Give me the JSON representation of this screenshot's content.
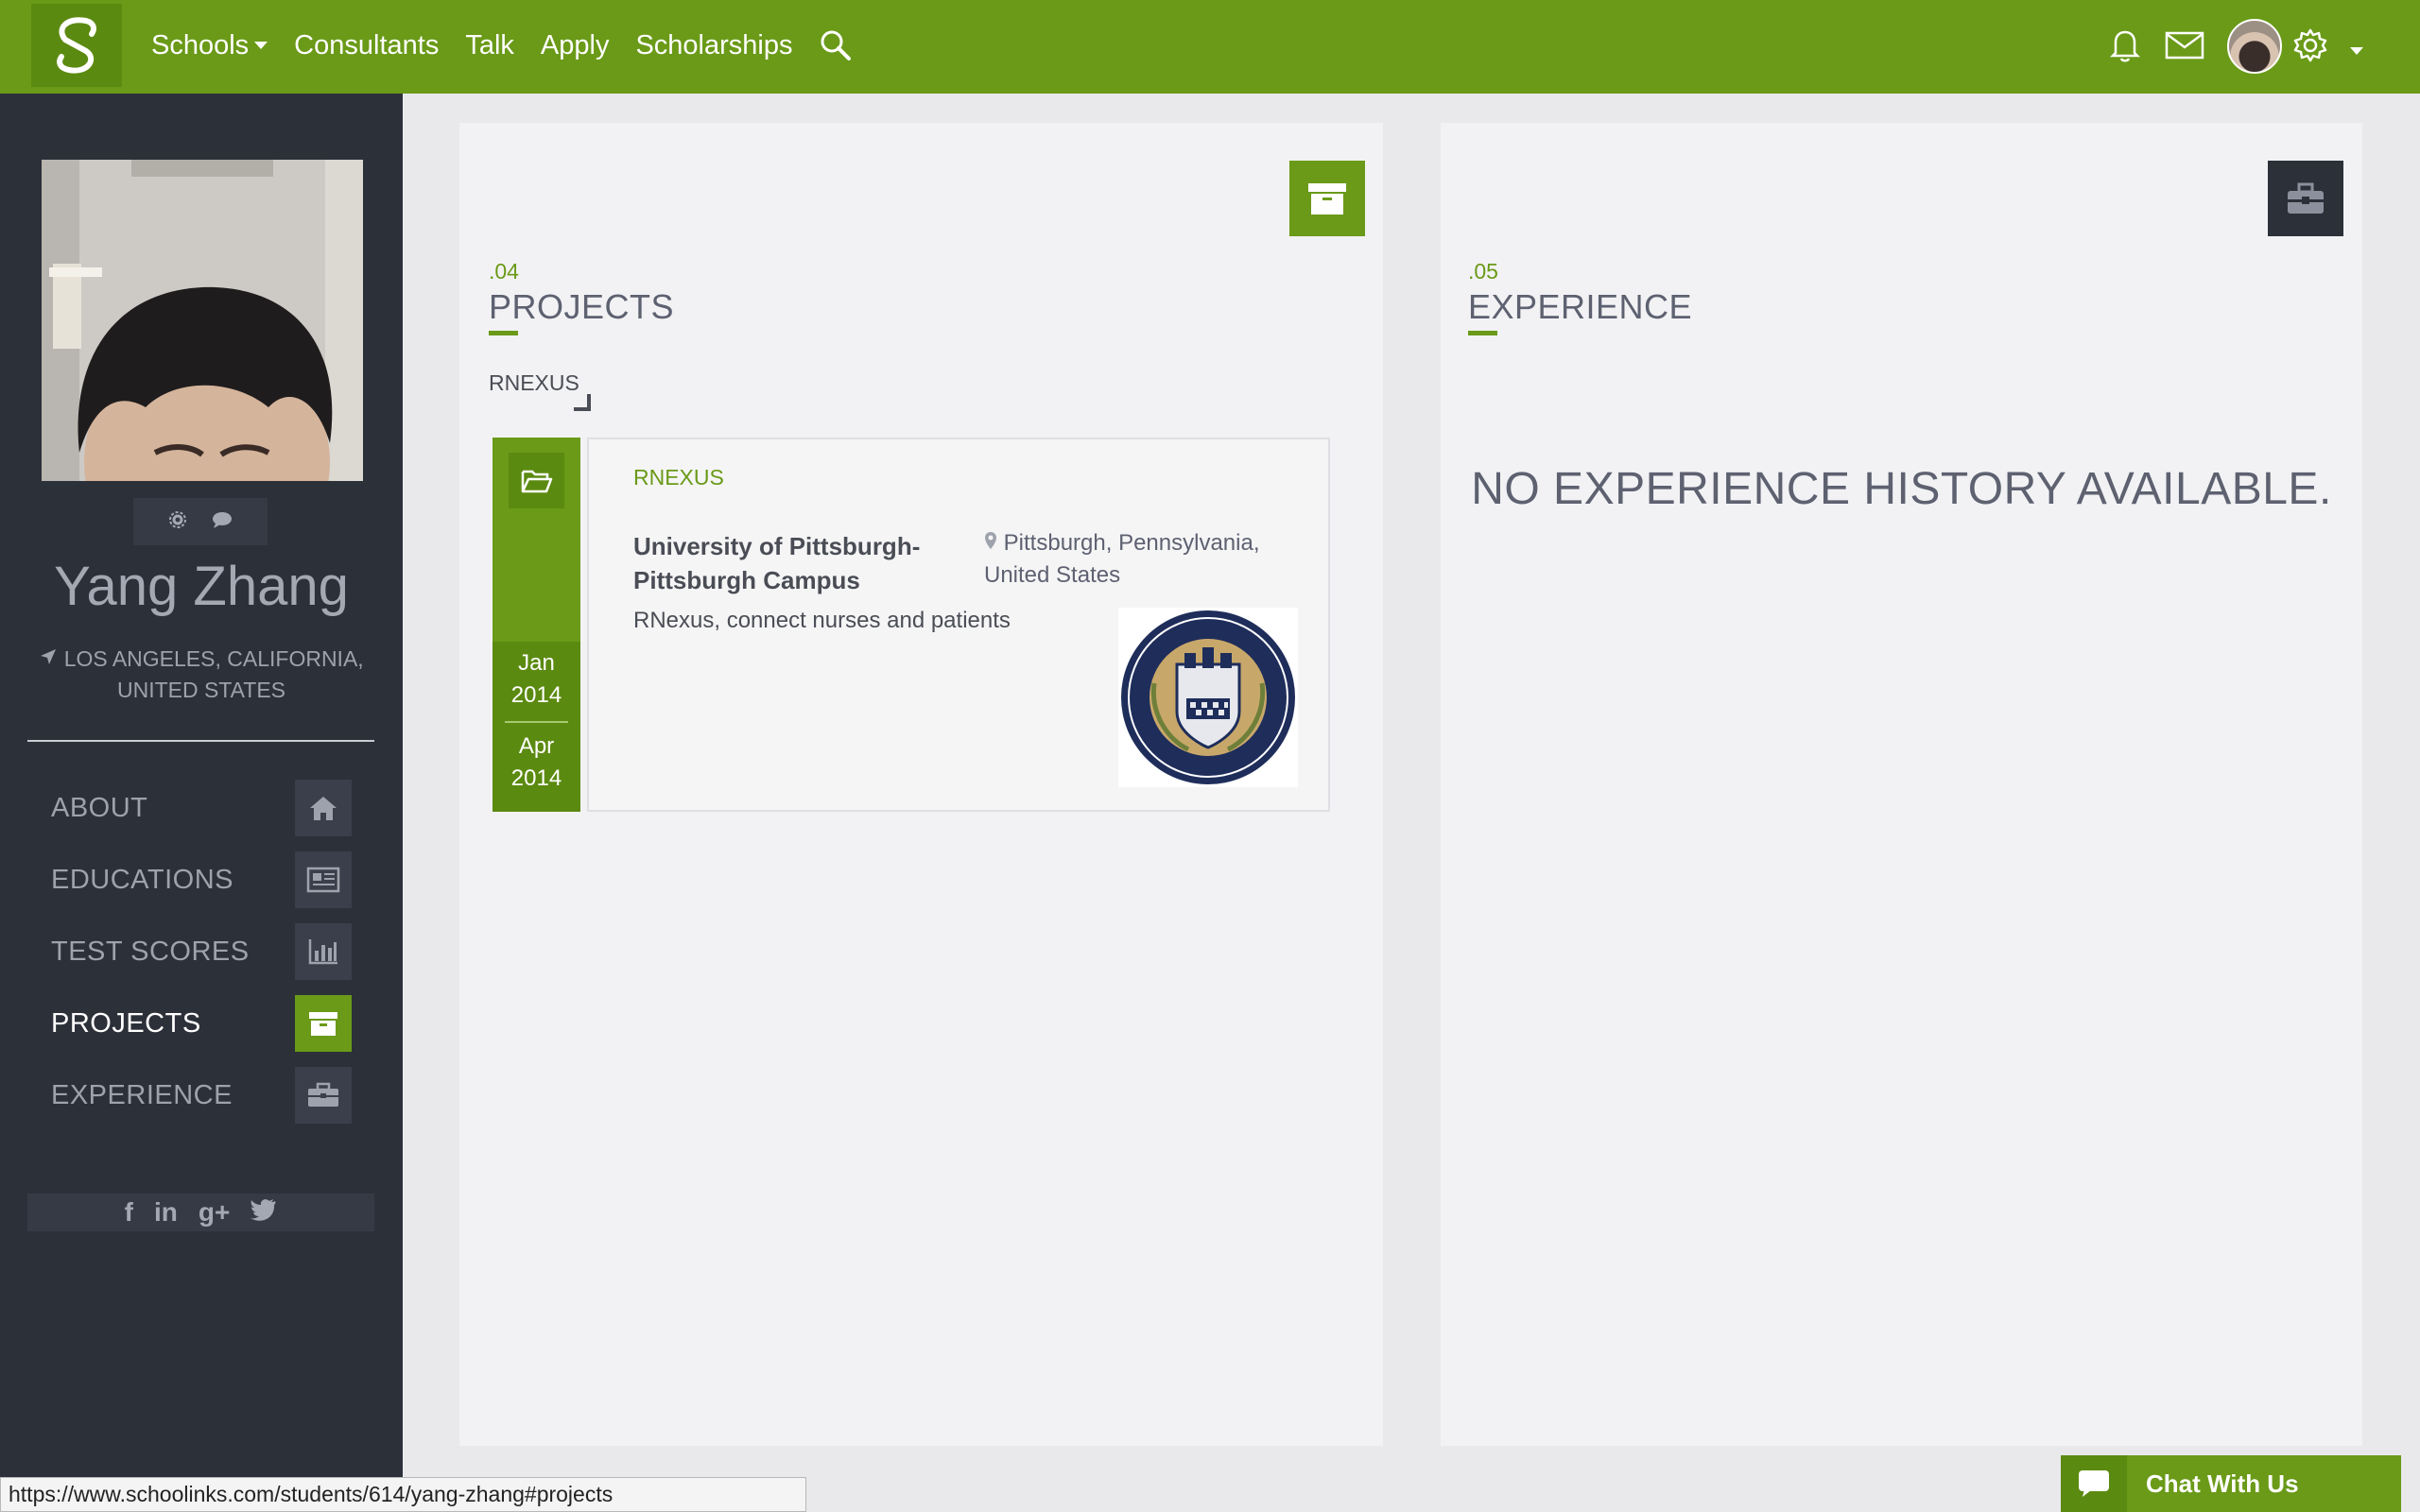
{
  "nav": {
    "links": [
      {
        "label": "Schools",
        "dropdown": true
      },
      {
        "label": "Consultants"
      },
      {
        "label": "Talk"
      },
      {
        "label": "Apply"
      },
      {
        "label": "Scholarships"
      }
    ],
    "icons": [
      "logo-icon",
      "search-icon",
      "bell-icon",
      "envelope-icon",
      "avatar",
      "gear-icon",
      "caret-down-icon"
    ]
  },
  "profile": {
    "name": "Yang Zhang",
    "location": "LOS ANGELES, CALIFORNIA, UNITED STATES"
  },
  "sidebar": {
    "items": [
      {
        "label": "ABOUT",
        "icon": "home-icon"
      },
      {
        "label": "EDUCATIONS",
        "icon": "newspaper-icon"
      },
      {
        "label": "TEST SCORES",
        "icon": "bar-chart-icon"
      },
      {
        "label": "PROJECTS",
        "icon": "archive-icon",
        "active": true
      },
      {
        "label": "EXPERIENCE",
        "icon": "briefcase-icon"
      }
    ],
    "social": [
      "f",
      "in",
      "g+",
      "twitter"
    ]
  },
  "projects": {
    "number": ".04",
    "title": "PROJECTS",
    "group_label": "RNEXUS",
    "card": {
      "start": "Jan 2014",
      "start_month": "Jan",
      "start_year": "2014",
      "end_month": "Apr",
      "end_year": "2014",
      "title": "RNEXUS",
      "school": "University of Pittsburgh-Pittsburgh Campus",
      "location": "Pittsburgh, Pennsylvania, United States",
      "description": "RNexus, connect nurses and patients"
    }
  },
  "experience": {
    "number": ".05",
    "title": "EXPERIENCE",
    "empty_message": "NO EXPERIENCE HISTORY AVAILABLE."
  },
  "status_url": "https://www.schoolinks.com/students/614/yang-zhang#projects",
  "chat": {
    "label": "Chat With Us"
  },
  "colors": {
    "brand_green": "#6a9a18",
    "sidebar_bg": "#2c3039",
    "panel_bg": "#f2f2f4"
  }
}
